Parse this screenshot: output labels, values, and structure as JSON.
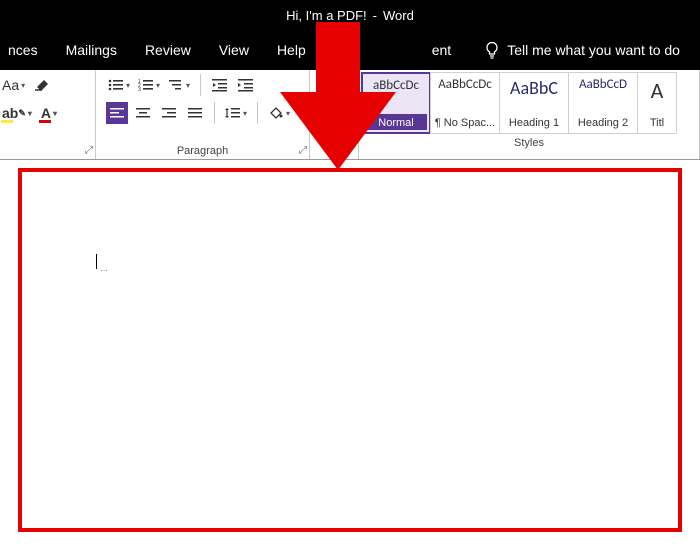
{
  "title": {
    "doc": "Hi, I'm a PDF!",
    "app": "Word"
  },
  "menu": {
    "nces": "nces",
    "mailings": "Mailings",
    "review": "Review",
    "view": "View",
    "help": "Help",
    "ent_partial": "ent",
    "tellme": "Tell me what you want to do"
  },
  "groups": {
    "paragraph": "Paragraph",
    "styles": "Styles"
  },
  "font": {
    "aa_label": "Aa",
    "abc": "abc",
    "arrowA": "A"
  },
  "styles": [
    {
      "preview": "aBbCcDc",
      "name": "Normal",
      "selected": true,
      "cls": "sp-small"
    },
    {
      "preview": "AaBbCcDc",
      "name": "¶ No Spac...",
      "selected": false,
      "cls": "sp-small"
    },
    {
      "preview": "AaBbC",
      "name": "Heading 1",
      "selected": false,
      "cls": "sp-med"
    },
    {
      "preview": "AaBbCcD",
      "name": "Heading 2",
      "selected": false,
      "cls": "sp-small"
    },
    {
      "preview": "A",
      "name": "Titl",
      "selected": false,
      "cls": "sp-lg"
    }
  ]
}
